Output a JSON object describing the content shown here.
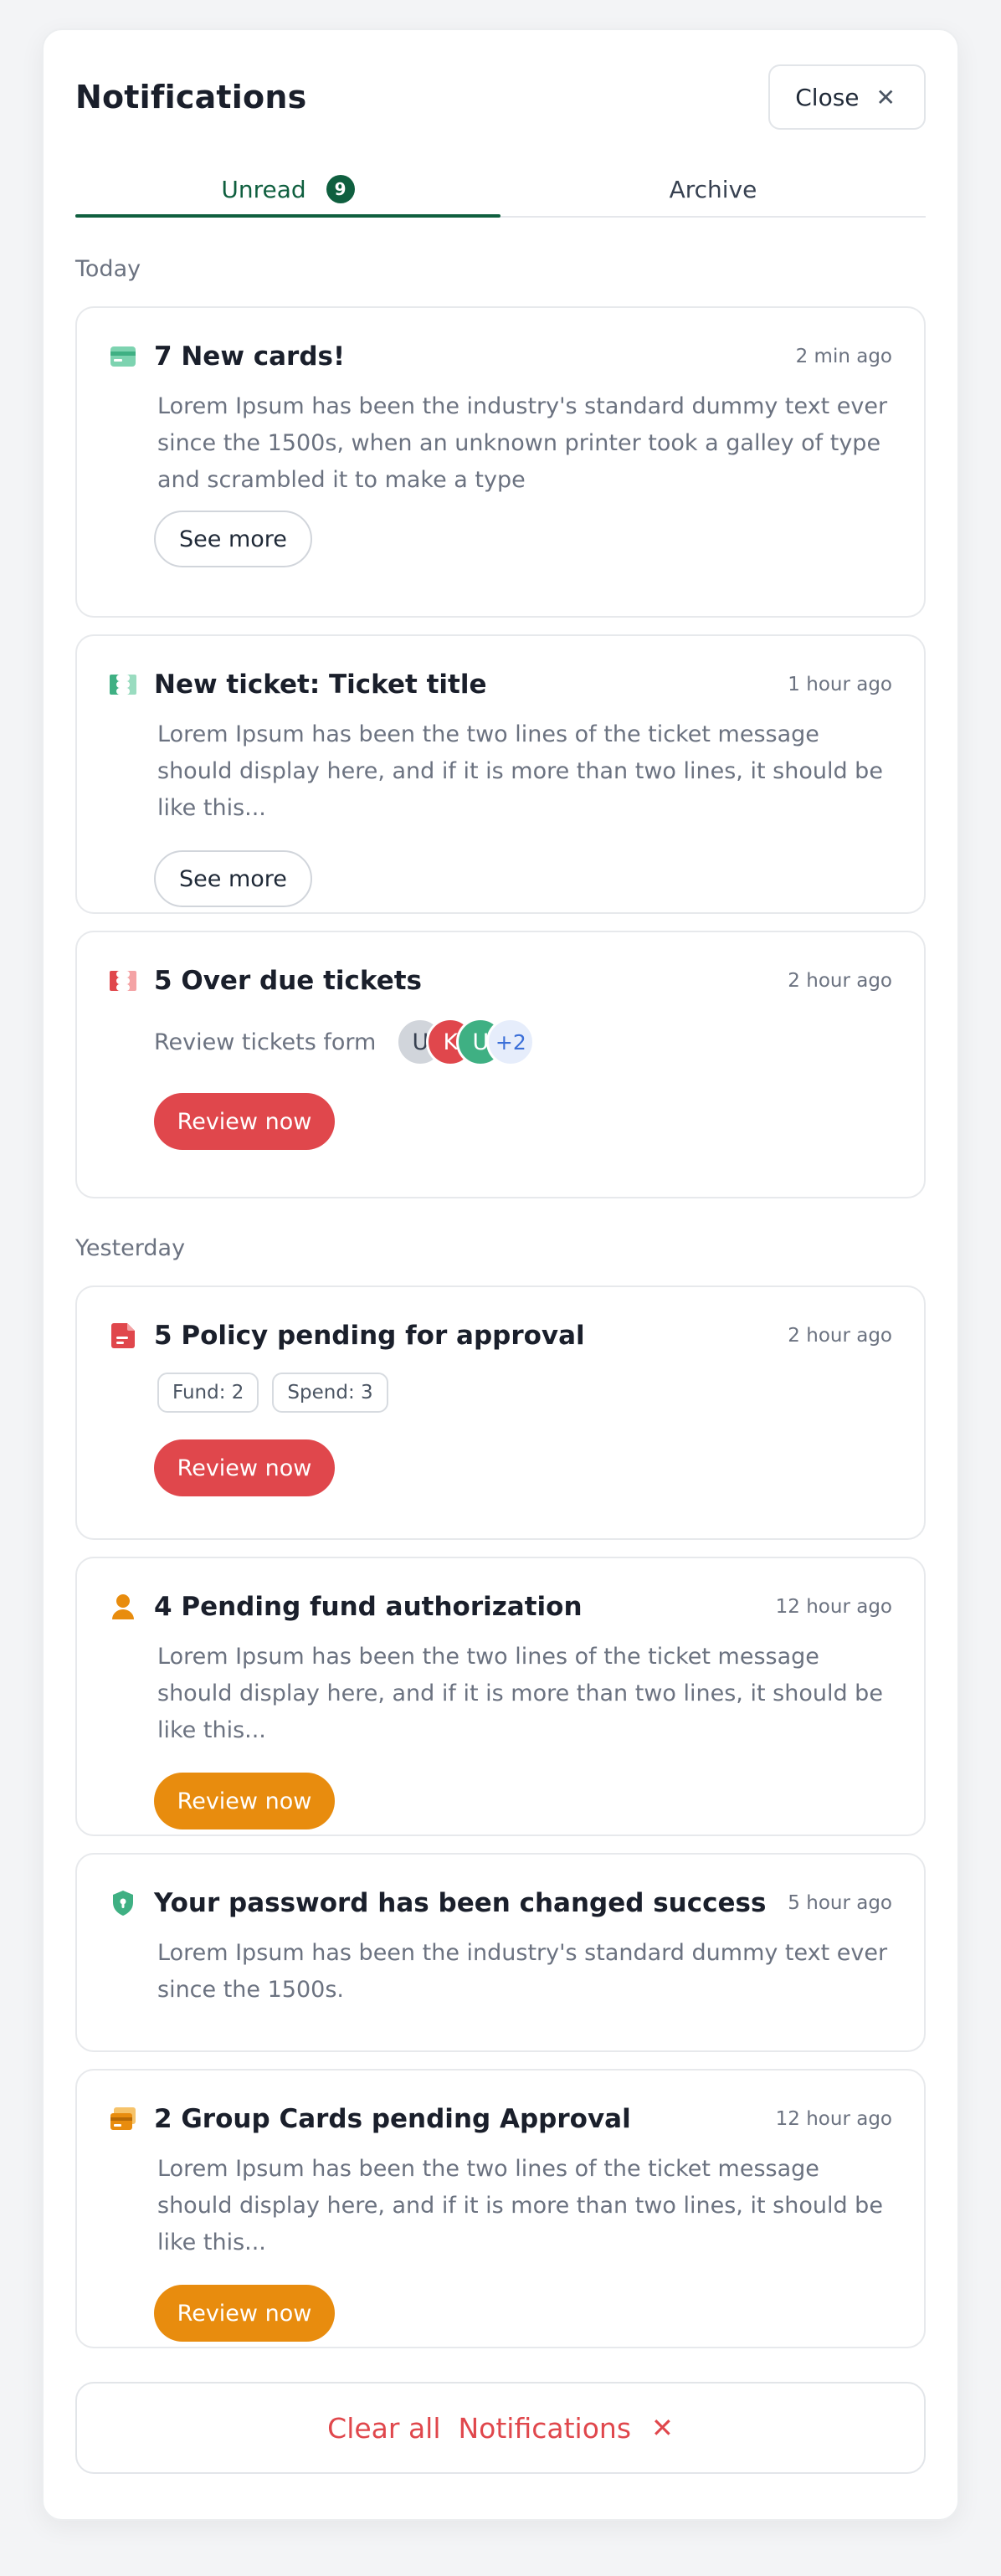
{
  "header": {
    "title": "Notifications",
    "close_label": "Close"
  },
  "tabs": [
    {
      "label": "Unread",
      "count": "9",
      "active": true
    },
    {
      "label": "Archive",
      "active": false
    }
  ],
  "sections": {
    "today": "Today",
    "yesterday": "Yesterday"
  },
  "cards": [
    {
      "title": "7 New cards!",
      "time": "2 min ago",
      "desc": "Lorem Ipsum has been the industry's standard dummy text ever since the 1500s, when an unknown printer took a galley of type and scrambled it to make a type",
      "button": "See more"
    },
    {
      "title": "New ticket: Ticket title",
      "time": "1 hour ago",
      "desc": "Lorem Ipsum has been the two lines of the ticket message should display here, and if it is more than two lines, it should be like this...",
      "button": "See more"
    },
    {
      "title": "5 Over due tickets",
      "time": "2 hour ago",
      "review_text": "Review tickets form",
      "avatars": [
        "U",
        "K",
        "U",
        "+2"
      ],
      "button": "Review now"
    },
    {
      "title": "5 Policy pending for approval",
      "time": "2 hour ago",
      "tags": [
        "Fund: 2",
        "Spend: 3"
      ],
      "button": "Review now"
    },
    {
      "title": "4 Pending fund authorization",
      "time": "12 hour ago",
      "desc": "Lorem Ipsum has been the two lines of the ticket message should display here, and if it is more than two lines, it should be like this...",
      "button": "Review now"
    },
    {
      "title": "Your password has been changed success",
      "time": "5 hour ago",
      "desc": "Lorem Ipsum has been the industry's standard dummy text ever since the 1500s."
    },
    {
      "title": "2 Group Cards pending Approval",
      "time": "12 hour ago",
      "desc": "Lorem Ipsum has been the two lines of the ticket message should display here, and if it is more than two lines, it should be like this...",
      "button": "Review now"
    }
  ],
  "footer": {
    "clear_label": "Clear all  Notifications"
  },
  "colors": {
    "accent_green": "#0f5f3f",
    "danger_red": "#e0474c",
    "warning_orange": "#e88c0e",
    "icon_green": "#3fb083"
  },
  "icons": [
    "close-icon",
    "credit-card-icon",
    "ticket-icon",
    "overdue-ticket-icon",
    "policy-document-icon",
    "user-icon",
    "shield-icon",
    "group-cards-icon"
  ]
}
